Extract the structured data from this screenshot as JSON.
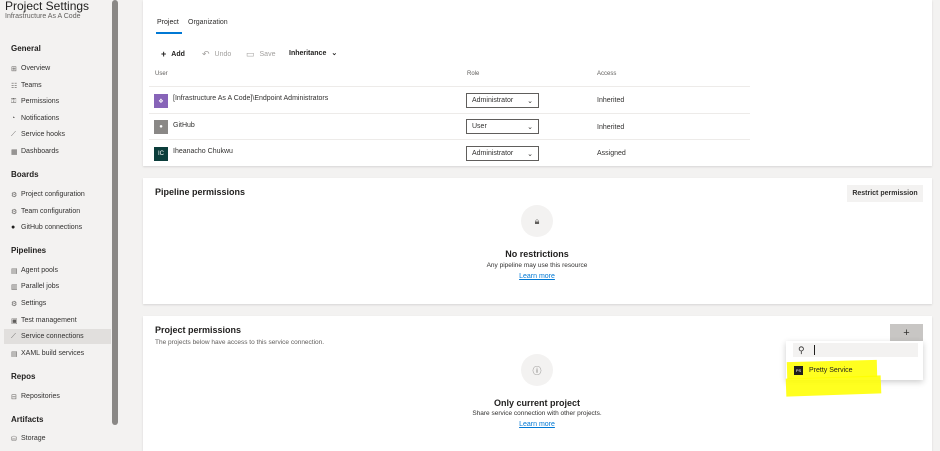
{
  "sidebar": {
    "title": "Project Settings",
    "subtitle": "Infrastructure As A Code",
    "sections": [
      {
        "label": "General",
        "items": [
          "Overview",
          "Teams",
          "Permissions",
          "Notifications",
          "Service hooks",
          "Dashboards"
        ]
      },
      {
        "label": "Boards",
        "items": [
          "Project configuration",
          "Team configuration",
          "GitHub connections"
        ]
      },
      {
        "label": "Pipelines",
        "items": [
          "Agent pools",
          "Parallel jobs",
          "Settings",
          "Test management",
          "Service connections",
          "XAML build services"
        ]
      },
      {
        "label": "Repos",
        "items": [
          "Repositories"
        ]
      },
      {
        "label": "Artifacts",
        "items": [
          "Storage"
        ]
      }
    ],
    "active_item": "Service connections"
  },
  "security": {
    "tabs": [
      "Project",
      "Organization"
    ],
    "active_tab": "Project",
    "toolbar": {
      "add": "Add",
      "undo": "Undo",
      "save": "Save",
      "inheritance": "Inheritance"
    },
    "columns": {
      "user": "User",
      "role": "Role",
      "access": "Access"
    },
    "rows": [
      {
        "user": "[Infrastructure As A Code]\\Endpoint Administrators",
        "role": "Administrator",
        "access": "Inherited",
        "avatar": "group-icon"
      },
      {
        "user": "GitHub",
        "role": "User",
        "access": "Inherited",
        "avatar": "person-icon"
      },
      {
        "user": "Iheanacho Chukwu",
        "role": "Administrator",
        "access": "Assigned",
        "avatar_initials": "IC"
      }
    ]
  },
  "pipeline_permissions": {
    "title": "Pipeline permissions",
    "restrict_button": "Restrict permission",
    "empty_title": "No restrictions",
    "empty_text": "Any pipeline may use this resource",
    "link": "Learn more",
    "icon": "lock-icon"
  },
  "project_permissions": {
    "title": "Project permissions",
    "subtitle": "The projects below have access to this service connection.",
    "add_button": "+",
    "empty_title": "Only current project",
    "empty_text": "Share service connection with other projects.",
    "link": "Learn more",
    "icon": "info-icon",
    "dropdown": {
      "search_value": "",
      "items": [
        {
          "label": "Pretty Service",
          "icon_text": "PS"
        }
      ]
    }
  },
  "colors": {
    "accent": "#0078d4",
    "highlight": "#ffff00",
    "sidebar_bg": "#f3f2f1"
  }
}
